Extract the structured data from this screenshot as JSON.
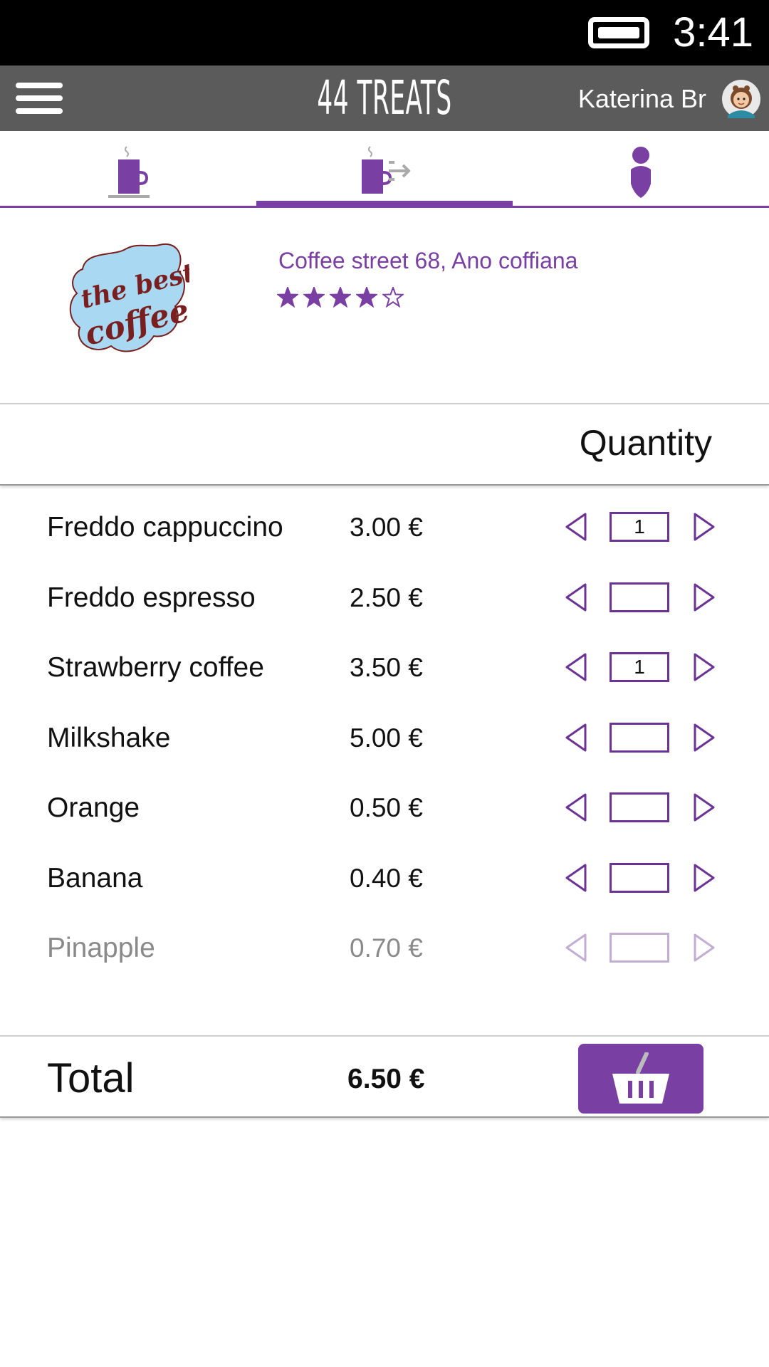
{
  "status_bar": {
    "time": "3:41",
    "battery_icon": "battery-icon"
  },
  "app_bar": {
    "menu_icon": "hamburger-menu-icon",
    "title": "44 TREATS",
    "user_name": "Katerina Br",
    "avatar_icon": "user-avatar"
  },
  "tabs": [
    {
      "icon": "coffee-cup-icon",
      "active": false
    },
    {
      "icon": "coffee-takeaway-icon",
      "active": true
    },
    {
      "icon": "person-icon",
      "active": false
    }
  ],
  "shop": {
    "logo_text": "the best coffee",
    "address": "Coffee street 68, Ano coffiana",
    "rating": 4,
    "rating_max": 5
  },
  "quantity_header": "Quantity",
  "items": [
    {
      "name": "Freddo cappuccino",
      "price": "3.00 €",
      "quantity": "1",
      "enabled": true
    },
    {
      "name": "Freddo espresso",
      "price": "2.50 €",
      "quantity": "",
      "enabled": true
    },
    {
      "name": "Strawberry coffee",
      "price": "3.50 €",
      "quantity": "1",
      "enabled": true
    },
    {
      "name": "Milkshake",
      "price": "5.00 €",
      "quantity": "",
      "enabled": true
    },
    {
      "name": "Orange",
      "price": "0.50 €",
      "quantity": "",
      "enabled": true
    },
    {
      "name": "Banana",
      "price": "0.40 €",
      "quantity": "",
      "enabled": true
    },
    {
      "name": "Pinapple",
      "price": "0.70 €",
      "quantity": "",
      "enabled": false
    }
  ],
  "total": {
    "label": "Total",
    "value": "6.50 €",
    "basket_icon": "basket-icon"
  },
  "colors": {
    "accent": "#7a3fa2",
    "app_bar": "#5b5b5b",
    "status_bar": "#000000",
    "logo_bg": "#a9d9f2",
    "logo_text": "#7a1f1f"
  }
}
